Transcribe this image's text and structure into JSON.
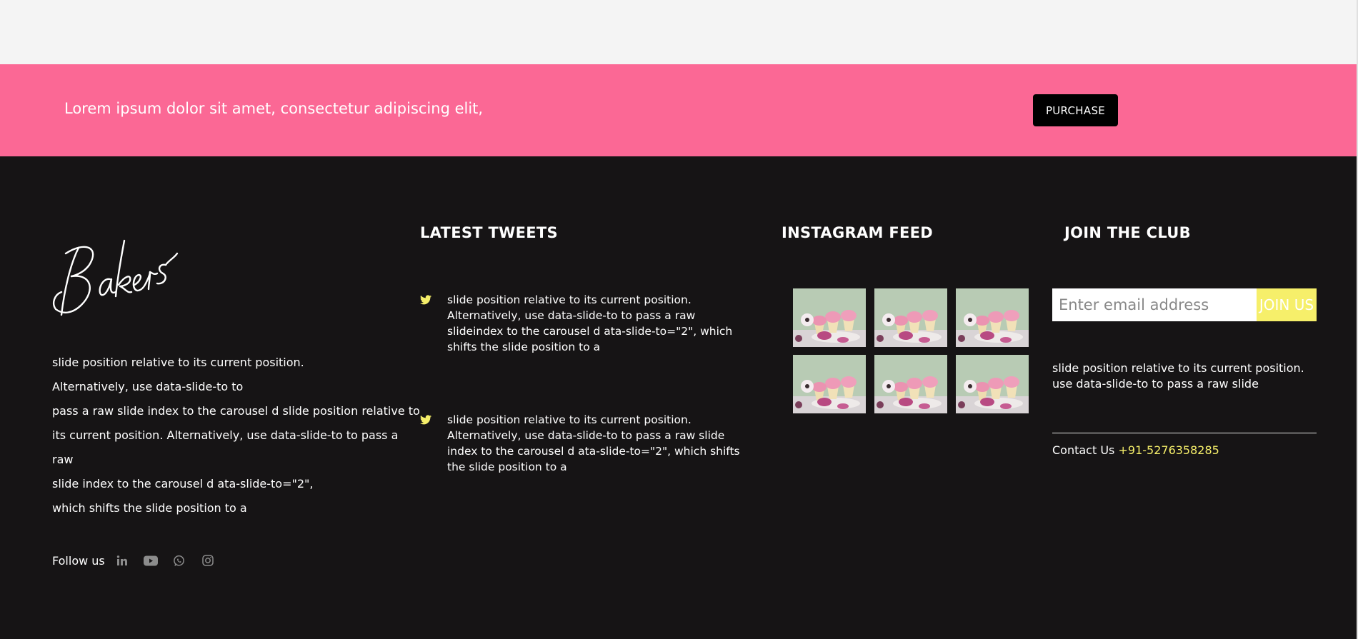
{
  "cta": {
    "text": "Lorem ipsum dolor sit amet, consectetur adipiscing elit,",
    "button_label": "PURCHASE"
  },
  "about": {
    "logo_text": "Bakers",
    "lines": [
      "slide position relative to its current position.",
      "Alternatively, use data-slide-to to",
      "pass a raw slide index to the carousel d slide position relative to",
      "its current position. Alternatively, use data-slide-to to pass a",
      "raw",
      "slide index to the carousel d ata-slide-to=\"2\",",
      "which shifts the slide position to a"
    ],
    "follow_label": "Follow us",
    "social_icons": [
      "linkedin-icon",
      "youtube-icon",
      "whatsapp-icon",
      "instagram-icon"
    ]
  },
  "tweets": {
    "title": "LATEST TWEETS",
    "items": [
      "slide position relative to its current position. Alternatively, use data-slide-to to pass a raw slideindex to the carousel d ata-slide-to=\"2\", which shifts the slide position to a",
      "slide position relative to its current position. Alternatively, use data-slide-to to pass a raw slide index to the carousel d ata-slide-to=\"2\", which shifts the slide position to a"
    ]
  },
  "instagram": {
    "title": "INSTAGRAM FEED",
    "thumb_count": 6
  },
  "club": {
    "title": "JOIN THE CLUB",
    "email_placeholder": "Enter email address",
    "button_label": "JOIN US",
    "description": "slide position relative to its current position. use data-slide-to to pass a raw slide",
    "contact_label": "Contact Us",
    "phone": "+91-5276358285"
  },
  "colors": {
    "cta_background": "#fb6895",
    "footer_background": "#161415",
    "accent_yellow": "#f6ef6a",
    "button_black": "#000000"
  }
}
